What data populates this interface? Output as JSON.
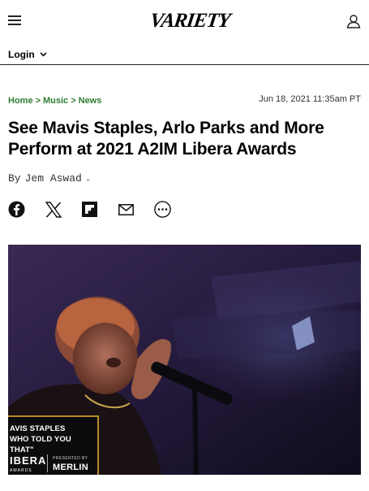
{
  "header": {
    "logo_text": "VARIETY",
    "menu_icon": "hamburger-menu-icon",
    "account_icon": "user-account-icon",
    "login_label": "Login"
  },
  "article": {
    "breadcrumb": [
      "Home",
      "Music",
      "News"
    ],
    "timestamp": "Jun 18, 2021 11:35am PT",
    "headline": "See Mavis Staples, Arlo Parks and More Perform at 2021 A2IM Libera Awards",
    "byline_prefix": "By",
    "author": "Jem Aswad"
  },
  "share_icons": [
    "facebook-icon",
    "x-twitter-icon",
    "flipboard-icon",
    "email-icon",
    "more-options-icon"
  ],
  "hero": {
    "lower_third_line1": "AVIS STAPLES",
    "lower_third_line2": "WHO TOLD YOU THAT\"",
    "event_logo": "IBERA",
    "event_logo_sub": "AWARDS",
    "presented_by": "PRESENTED BY",
    "sponsor": "MERLIN"
  },
  "colors": {
    "breadcrumb": "#2e7d32",
    "lower_third_border": "#b8892e"
  }
}
